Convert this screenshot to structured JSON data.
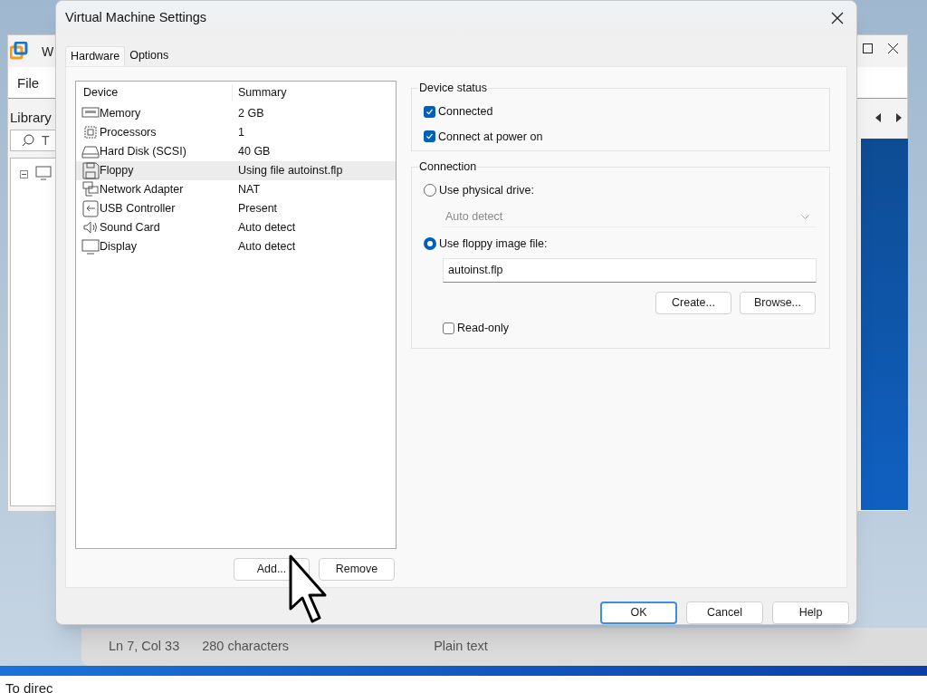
{
  "background": {
    "app_window": {
      "title": "W",
      "menu": [
        "File"
      ],
      "library_title": "Library",
      "search_placeholder": "T"
    },
    "editor_window": {
      "status": [
        "Ln 7, Col 33",
        "280 characters",
        "Plain text"
      ],
      "text": "To direc"
    }
  },
  "dialog": {
    "title": "Virtual Machine Settings",
    "tabs": [
      {
        "label": "Hardware",
        "selected": true
      },
      {
        "label": "Options",
        "selected": false
      }
    ],
    "columns": [
      "Device",
      "Summary"
    ],
    "devices": [
      {
        "kind": "memory",
        "name": "Memory",
        "summary": "2 GB",
        "selected": false
      },
      {
        "kind": "processor",
        "name": "Processors",
        "summary": "1",
        "selected": false
      },
      {
        "kind": "disk",
        "name": "Hard Disk (SCSI)",
        "summary": "40 GB",
        "selected": false
      },
      {
        "kind": "floppy",
        "name": "Floppy",
        "summary": "Using file autoinst.flp",
        "selected": true
      },
      {
        "kind": "network",
        "name": "Network Adapter",
        "summary": "NAT",
        "selected": false
      },
      {
        "kind": "usb",
        "name": "USB Controller",
        "summary": "Present",
        "selected": false
      },
      {
        "kind": "sound",
        "name": "Sound Card",
        "summary": "Auto detect",
        "selected": false
      },
      {
        "kind": "display",
        "name": "Display",
        "summary": "Auto detect",
        "selected": false
      }
    ],
    "list_buttons": [
      "Add...",
      "Remove"
    ],
    "device_status": {
      "title": "Device status",
      "options": [
        {
          "label": "Connected",
          "checked": true
        },
        {
          "label": "Connect at power on",
          "checked": true
        }
      ]
    },
    "connection": {
      "title": "Connection",
      "physical": {
        "label": "Use physical drive:",
        "selected": false
      },
      "drive": {
        "value": "Auto detect",
        "disabled": true
      },
      "image": {
        "label": "Use floppy image file:",
        "selected": true
      },
      "file": "autoinst.flp",
      "buttons": [
        "Create...",
        "Browse..."
      ],
      "read_only": {
        "label": "Read-only",
        "checked": false
      }
    },
    "footer_buttons": [
      {
        "label": "OK",
        "default": true
      },
      {
        "label": "Cancel",
        "default": false
      },
      {
        "label": "Help",
        "default": false
      }
    ]
  }
}
